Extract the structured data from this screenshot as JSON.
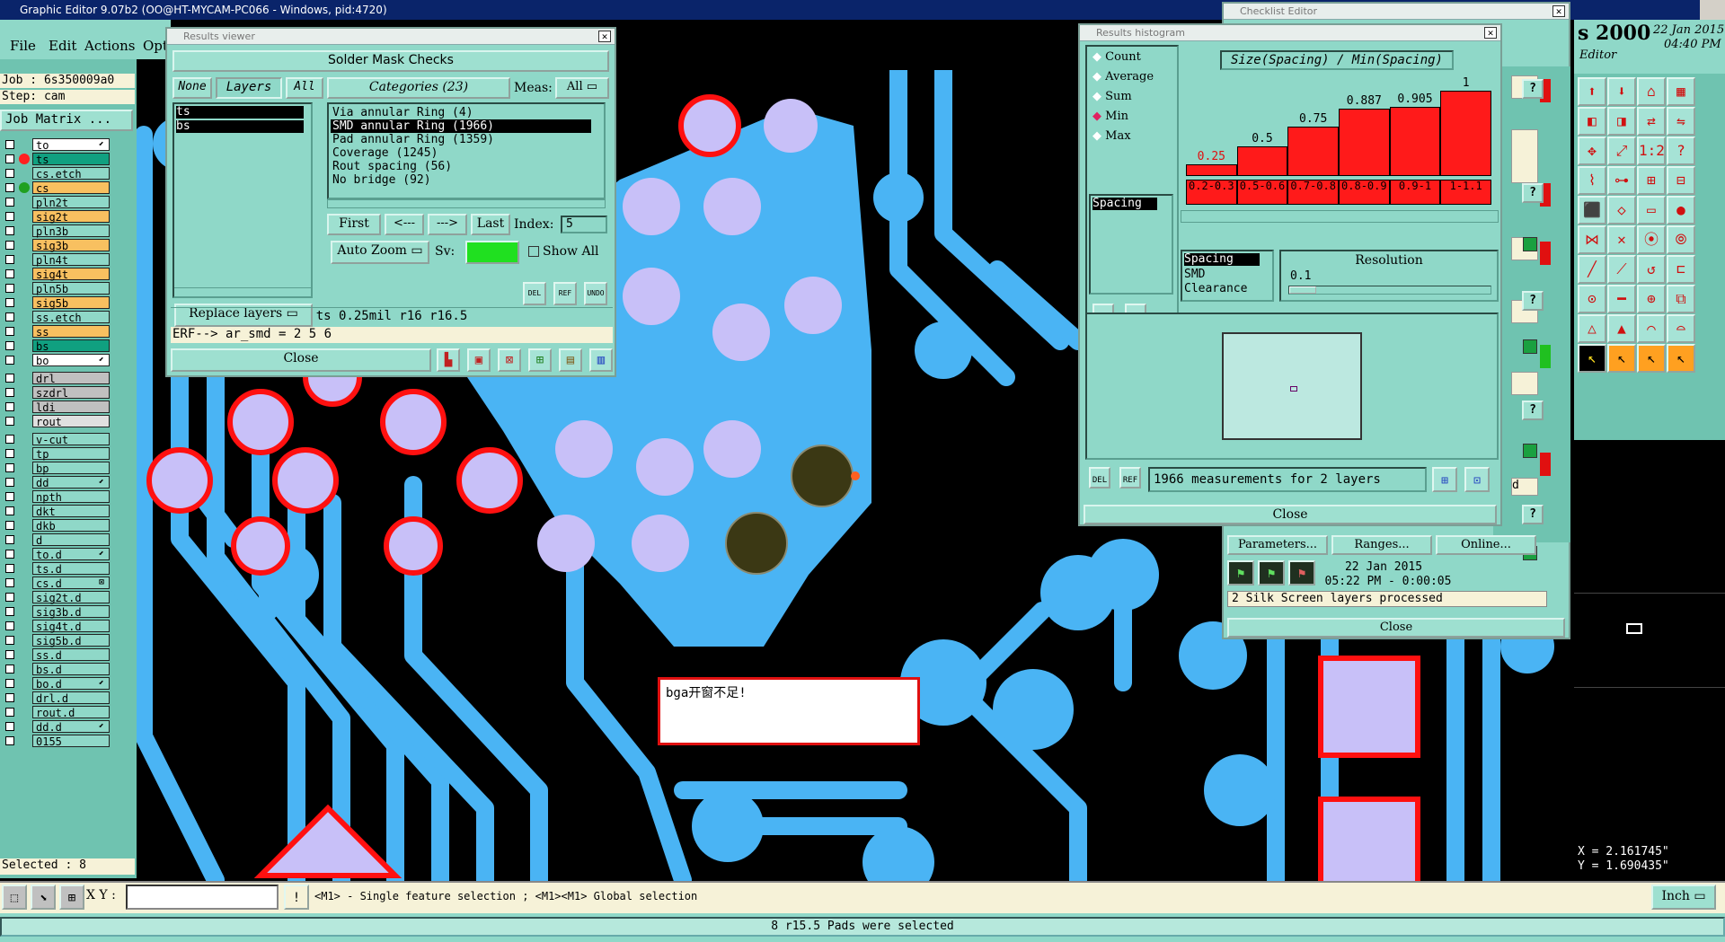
{
  "app": {
    "title": "Graphic Editor 9.07b2 (OO@HT-MYCAM-PC066 - Windows, pid:4720)",
    "date": "22 Jan 2015",
    "time": "04:40 PM",
    "brand_partial": "s 2000",
    "brand_sub": "Editor"
  },
  "menu": {
    "items": [
      "File",
      "Edit",
      "Actions",
      "Opti"
    ]
  },
  "job": {
    "job_label": "Job : 6s350009a0",
    "step_label": "Step: cam",
    "matrix_button": "Job Matrix ...",
    "selected": "Selected : 8"
  },
  "layers": [
    {
      "name": "to",
      "color": "#ffffff",
      "mark": "⬋"
    },
    {
      "name": "ts",
      "color": "#10a080",
      "dot": "#ff2020"
    },
    {
      "name": "cs.etch",
      "color": "#8fd8c8"
    },
    {
      "name": "cs",
      "color": "#f8c060",
      "dot": "#20a020"
    },
    {
      "name": "pln2t",
      "color": "#8fd8c8"
    },
    {
      "name": "sig2t",
      "color": "#f8c060"
    },
    {
      "name": "pln3b",
      "color": "#8fd8c8"
    },
    {
      "name": "sig3b",
      "color": "#f8c060"
    },
    {
      "name": "pln4t",
      "color": "#8fd8c8"
    },
    {
      "name": "sig4t",
      "color": "#f8c060"
    },
    {
      "name": "pln5b",
      "color": "#8fd8c8"
    },
    {
      "name": "sig5b",
      "color": "#f8c060"
    },
    {
      "name": "ss.etch",
      "color": "#8fd8c8"
    },
    {
      "name": "ss",
      "color": "#f8c060"
    },
    {
      "name": "bs",
      "color": "#10a080"
    },
    {
      "name": "bo",
      "color": "#ffffff",
      "mark": "⬋"
    },
    {
      "name": "drl",
      "color": "#c0c0c0"
    },
    {
      "name": "szdrl",
      "color": "#c0c0c0"
    },
    {
      "name": "ldi",
      "color": "#c0c0c0"
    },
    {
      "name": "rout",
      "color": "#e0e0e0"
    },
    {
      "name": "v-cut",
      "color": "#8fd8c8"
    },
    {
      "name": "tp",
      "color": "#8fd8c8"
    },
    {
      "name": "bp",
      "color": "#8fd8c8"
    },
    {
      "name": "dd",
      "color": "#8fd8c8",
      "mark": "⬋"
    },
    {
      "name": "npth",
      "color": "#8fd8c8"
    },
    {
      "name": "dkt",
      "color": "#8fd8c8"
    },
    {
      "name": "dkb",
      "color": "#8fd8c8"
    },
    {
      "name": "d",
      "color": "#8fd8c8"
    },
    {
      "name": "to.d",
      "color": "#8fd8c8",
      "mark": "⬋"
    },
    {
      "name": "ts.d",
      "color": "#8fd8c8"
    },
    {
      "name": "cs.d",
      "color": "#8fd8c8",
      "mark": "⊠"
    },
    {
      "name": "sig2t.d",
      "color": "#8fd8c8"
    },
    {
      "name": "sig3b.d",
      "color": "#8fd8c8"
    },
    {
      "name": "sig4t.d",
      "color": "#8fd8c8"
    },
    {
      "name": "sig5b.d",
      "color": "#8fd8c8"
    },
    {
      "name": "ss.d",
      "color": "#8fd8c8"
    },
    {
      "name": "bs.d",
      "color": "#8fd8c8"
    },
    {
      "name": "bo.d",
      "color": "#8fd8c8",
      "mark": "⬋"
    },
    {
      "name": "drl.d",
      "color": "#8fd8c8"
    },
    {
      "name": "rout.d",
      "color": "#8fd8c8"
    },
    {
      "name": "dd.d",
      "color": "#8fd8c8",
      "mark": "⬋"
    },
    {
      "name": "0155",
      "color": "#8fd8c8"
    }
  ],
  "results_viewer": {
    "title": "Results viewer",
    "header": "Solder Mask Checks",
    "btn_none": "None",
    "btn_layers": "Layers",
    "btn_all": "All",
    "layer_list": [
      "ts",
      "bs"
    ],
    "categories_label": "Categories (23)",
    "meas_label": "Meas:",
    "meas_value": "All",
    "categories": [
      "Via annular Ring (4)",
      "SMD annular Ring (1966)",
      "Pad annular Ring (1359)",
      "Coverage (1245)",
      "Rout spacing (56)",
      "No bridge (92)"
    ],
    "selected_category": "SMD annular Ring (1966)",
    "nav": {
      "first": "First",
      "prev": "<---",
      "next": "--->",
      "last": "Last",
      "index_label": "Index:",
      "index_value": "5"
    },
    "auto_zoom": "Auto Zoom",
    "sv_label": "Sv:",
    "show_all": "Show All",
    "replace_layers": "Replace layers",
    "info_line": "ts 0.25mil  r16  r16.5",
    "erf_line": "ERF--> ar_smd = 2 5 6",
    "close": "Close",
    "small_btns": [
      "DEL",
      "REF",
      "UNDO"
    ]
  },
  "histogram": {
    "title": "Results histogram",
    "modes": [
      "Count",
      "Average",
      "Sum",
      "Min",
      "Max"
    ],
    "selected_mode": "Min",
    "heading": "Size(Spacing) / Min(Spacing)",
    "list_item": "Spacing",
    "bins": [
      "0.2-0.3",
      "0.5-0.6",
      "0.7-0.8",
      "0.8-0.9",
      "0.9-1",
      "1-1.1"
    ],
    "bin_values": [
      "0.25",
      "0.5",
      "0.75",
      "0.887",
      "0.905",
      "1"
    ],
    "bin_heights": [
      0.12,
      0.3,
      0.5,
      0.68,
      0.7,
      0.86
    ],
    "types": [
      "Spacing",
      "SMD",
      "Clearance"
    ],
    "resolution_label": "Resolution",
    "resolution_value": "0.1",
    "summary": "1966 measurements for 2 layers",
    "close": "Close",
    "small_btns": [
      "DEL",
      "REF"
    ]
  },
  "checklist": {
    "title": "Checklist Editor",
    "parameters": "Parameters...",
    "ranges": "Ranges...",
    "online": "Online...",
    "date": "22 Jan 2015",
    "time_line": "05:22 PM - 0:00:05",
    "message": "2 Silk Screen layers processed",
    "close": "Close",
    "partial_letter": "d"
  },
  "annotation": {
    "text": "bga开窗不足!"
  },
  "coords": {
    "x": "X = 2.161745\"",
    "y": "Y = 1.690435\""
  },
  "status": {
    "xy_label": "X Y :",
    "hint": "<M1> - Single feature selection ; <M1><M1> Global selection",
    "unit": "Inch"
  },
  "message": {
    "text": "8 r15.5 Pads were selected"
  },
  "colors": {
    "panel": "#8fd8c8",
    "pcb_trace": "#4ab4f4",
    "pad_fill": "#c8c0f8",
    "pad_ring": "#ff1010",
    "board": "#000000"
  }
}
